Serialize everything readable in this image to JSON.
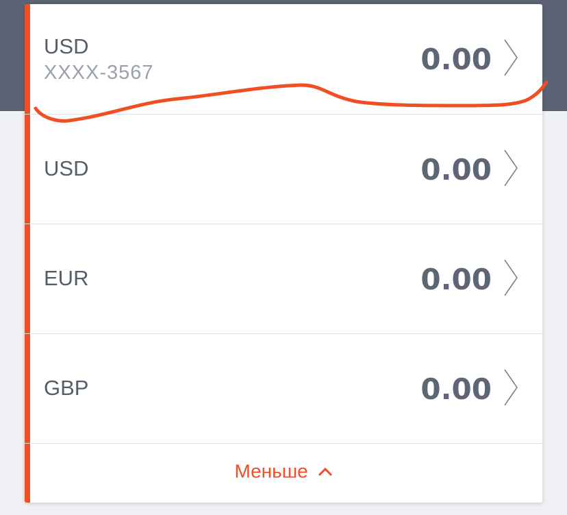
{
  "accounts": [
    {
      "currency": "USD",
      "account": "XXXX-3567",
      "amount": "0.00"
    },
    {
      "currency": "USD",
      "amount": "0.00"
    },
    {
      "currency": "EUR",
      "amount": "0.00"
    },
    {
      "currency": "GBP",
      "amount": "0.00"
    }
  ],
  "footer": {
    "less_label": "Меньше"
  },
  "colors": {
    "accent": "#f04e23",
    "header_bg": "#5b6374",
    "amount": "#5e6676"
  },
  "icons": {
    "row_arrow": "chevron-right-icon",
    "less_arrow": "chevron-up-icon"
  }
}
